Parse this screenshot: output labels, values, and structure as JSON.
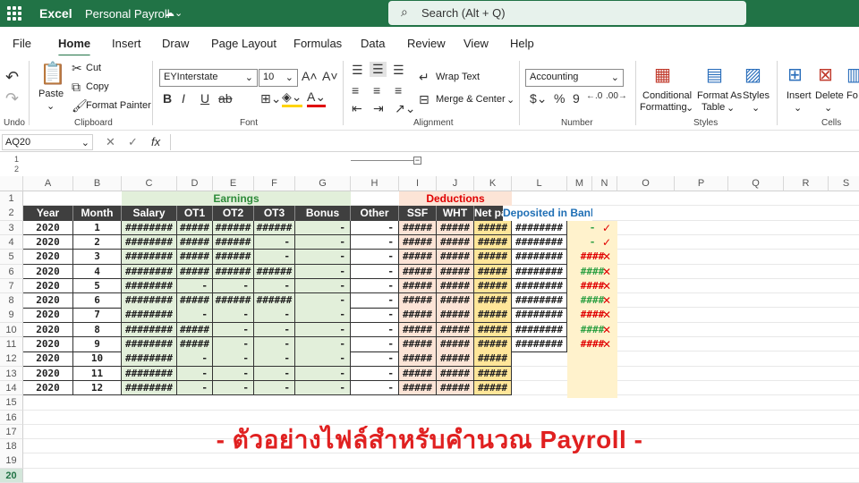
{
  "titlebar": {
    "app": "Excel",
    "doc": "Personal Payroll",
    "doc_icon": "cloud-saved-icon",
    "search": "Search (Alt + Q)"
  },
  "menu": [
    "File",
    "Home",
    "Insert",
    "Draw",
    "Page Layout",
    "Formulas",
    "Data",
    "Review",
    "View",
    "Help"
  ],
  "active_menu": "Home",
  "ribbon": {
    "undo": "Undo",
    "paste": "Paste",
    "cut": "Cut",
    "copy": "Copy",
    "format_painter": "Format Painter",
    "clipboard": "Clipboard",
    "font_name": "EYInterstate",
    "font_size": "10",
    "font": "Font",
    "wrap_text": "Wrap Text",
    "merge_center": "Merge & Center",
    "alignment": "Alignment",
    "number_format": "Accounting",
    "number": "Number",
    "conditional": "Conditional",
    "formatting": "Formatting",
    "format_as": "Format As",
    "table": "Table",
    "cell_styles": "Styles",
    "styles": "Styles",
    "insert": "Insert",
    "delete": "Delete",
    "format": "Fo",
    "cells": "Cells"
  },
  "name_box": "AQ20",
  "fx": "fx",
  "columns": [
    "A",
    "B",
    "C",
    "D",
    "E",
    "F",
    "G",
    "H",
    "I",
    "J",
    "K",
    "L",
    "M",
    "N",
    "O",
    "P",
    "Q",
    "R",
    "S"
  ],
  "group_labels": {
    "earnings": "Earnings",
    "deductions": "Deductions"
  },
  "headers": [
    "Year",
    "Month",
    "Salary",
    "OT1",
    "OT2",
    "OT3",
    "Bonus",
    "Other",
    "SSF",
    "WHT",
    "Net paid",
    "Deposited in Bank"
  ],
  "rows": [
    {
      "r": "3",
      "year": "2020",
      "month": "1",
      "salary": "########",
      "ot1": "#####",
      "ot2": "######",
      "ot3": "######",
      "bonus": "-",
      "other": "-",
      "ssf": "#####",
      "wht": "#####",
      "net": "#####",
      "bank": "########",
      "m": "-",
      "n": "✓"
    },
    {
      "r": "4",
      "year": "2020",
      "month": "2",
      "salary": "########",
      "ot1": "#####",
      "ot2": "######",
      "ot3": "-",
      "bonus": "-",
      "other": "-",
      "ssf": "#####",
      "wht": "#####",
      "net": "#####",
      "bank": "########",
      "m": "-",
      "n": "✓"
    },
    {
      "r": "5",
      "year": "2020",
      "month": "3",
      "salary": "########",
      "ot1": "#####",
      "ot2": "######",
      "ot3": "-",
      "bonus": "-",
      "other": "-",
      "ssf": "#####",
      "wht": "#####",
      "net": "#####",
      "bank": "########",
      "m": "####",
      "n": "✕"
    },
    {
      "r": "6",
      "year": "2020",
      "month": "4",
      "salary": "########",
      "ot1": "#####",
      "ot2": "######",
      "ot3": "######",
      "bonus": "-",
      "other": "-",
      "ssf": "#####",
      "wht": "#####",
      "net": "#####",
      "bank": "########",
      "m": "####",
      "n": "✕"
    },
    {
      "r": "7",
      "year": "2020",
      "month": "5",
      "salary": "########",
      "ot1": "-",
      "ot2": "-",
      "ot3": "-",
      "bonus": "-",
      "other": "-",
      "ssf": "#####",
      "wht": "#####",
      "net": "#####",
      "bank": "########",
      "m": "####",
      "n": "✕"
    },
    {
      "r": "8",
      "year": "2020",
      "month": "6",
      "salary": "########",
      "ot1": "#####",
      "ot2": "######",
      "ot3": "######",
      "bonus": "-",
      "other": "-",
      "ssf": "#####",
      "wht": "#####",
      "net": "#####",
      "bank": "########",
      "m": "####",
      "n": "✕"
    },
    {
      "r": "9",
      "year": "2020",
      "month": "7",
      "salary": "########",
      "ot1": "-",
      "ot2": "-",
      "ot3": "-",
      "bonus": "-",
      "other": "-",
      "ssf": "#####",
      "wht": "#####",
      "net": "#####",
      "bank": "########",
      "m": "####",
      "n": "✕"
    },
    {
      "r": "10",
      "year": "2020",
      "month": "8",
      "salary": "########",
      "ot1": "#####",
      "ot2": "-",
      "ot3": "-",
      "bonus": "-",
      "other": "-",
      "ssf": "#####",
      "wht": "#####",
      "net": "#####",
      "bank": "########",
      "m": "####",
      "n": "✕"
    },
    {
      "r": "11",
      "year": "2020",
      "month": "9",
      "salary": "########",
      "ot1": "#####",
      "ot2": "-",
      "ot3": "-",
      "bonus": "-",
      "other": "-",
      "ssf": "#####",
      "wht": "#####",
      "net": "#####",
      "bank": "########",
      "m": "####",
      "n": "✕"
    },
    {
      "r": "12",
      "year": "2020",
      "month": "10",
      "salary": "########",
      "ot1": "-",
      "ot2": "-",
      "ot3": "-",
      "bonus": "-",
      "other": "-",
      "ssf": "#####",
      "wht": "#####",
      "net": "#####",
      "bank": "",
      "m": "",
      "n": ""
    },
    {
      "r": "13",
      "year": "2020",
      "month": "11",
      "salary": "########",
      "ot1": "-",
      "ot2": "-",
      "ot3": "-",
      "bonus": "-",
      "other": "-",
      "ssf": "#####",
      "wht": "#####",
      "net": "#####",
      "bank": "",
      "m": "",
      "n": ""
    },
    {
      "r": "14",
      "year": "2020",
      "month": "12",
      "salary": "########",
      "ot1": "-",
      "ot2": "-",
      "ot3": "-",
      "bonus": "-",
      "other": "-",
      "ssf": "#####",
      "wht": "#####",
      "net": "#####",
      "bank": "",
      "m": "",
      "n": ""
    }
  ],
  "row_numbers": [
    "1",
    "2",
    "3",
    "4",
    "5",
    "6",
    "7",
    "8",
    "9",
    "10",
    "11",
    "12",
    "13",
    "14",
    "15",
    "16",
    "17",
    "18",
    "19",
    "20"
  ],
  "selected_row": "20",
  "outline_levels": [
    "1",
    "2"
  ],
  "banner": "- ตัวอย่างไฟล์สำหรับคำนวณ Payroll -",
  "colors": {
    "excel_green": "#217346",
    "m_red": "#e00000",
    "m_green": "#2ea043"
  }
}
